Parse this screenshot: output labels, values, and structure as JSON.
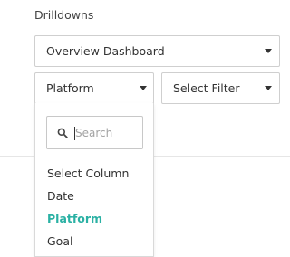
{
  "drilldowns": {
    "heading": "Drilldowns",
    "dashboard_select": {
      "value": "Overview Dashboard"
    },
    "column_select": {
      "value": "Platform"
    },
    "filter_select": {
      "value": "Select Filter"
    },
    "dropdown": {
      "search_placeholder": "Search",
      "options": [
        {
          "label": "Select Column",
          "selected": false
        },
        {
          "label": "Date",
          "selected": false
        },
        {
          "label": "Platform",
          "selected": true
        },
        {
          "label": "Goal",
          "selected": false
        }
      ]
    }
  },
  "colors": {
    "accent": "#2bb1a4",
    "border": "#cfcfcf",
    "text": "#333333"
  },
  "icons": {
    "search": "search-icon",
    "caret": "caret-down-icon"
  }
}
